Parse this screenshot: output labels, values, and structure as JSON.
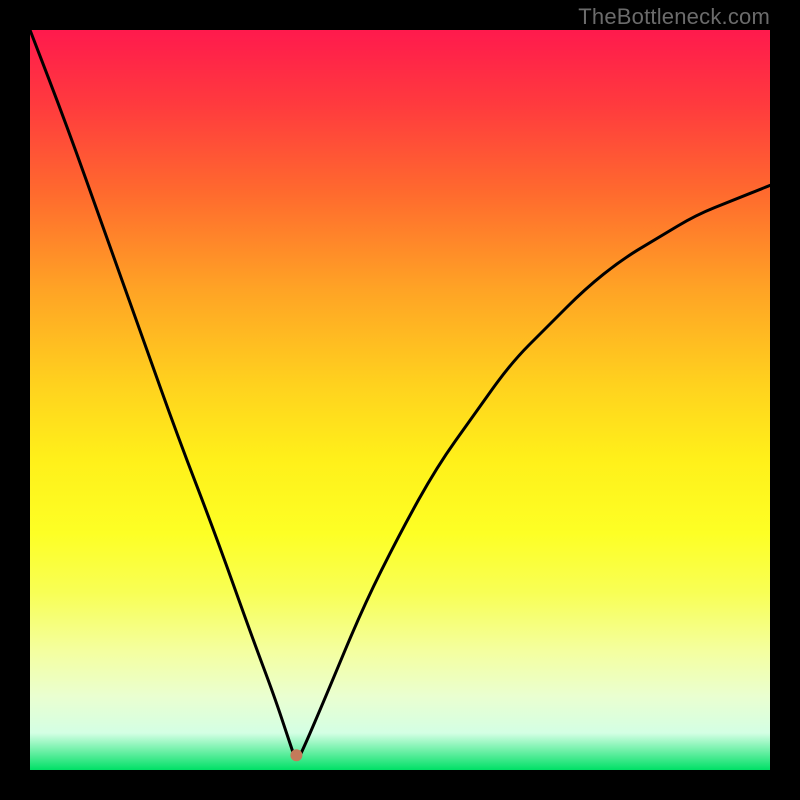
{
  "watermark": "TheBottleneck.com",
  "chart_data": {
    "type": "line",
    "title": "",
    "xlabel": "",
    "ylabel": "",
    "xlim": [
      0,
      100
    ],
    "ylim": [
      0,
      100
    ],
    "background": {
      "gradient": "vertical",
      "colors": [
        "#ff1a4d",
        "#ffd21e",
        "#fdff25",
        "#00e066"
      ],
      "meaning": "red=high bottleneck, green=low bottleneck"
    },
    "marker": {
      "x": 36,
      "y": 2,
      "color": "#c47a5a"
    },
    "series": [
      {
        "name": "bottleneck-curve",
        "x": [
          0,
          5,
          10,
          15,
          20,
          25,
          30,
          33,
          35,
          36,
          37,
          40,
          45,
          50,
          55,
          60,
          65,
          70,
          75,
          80,
          85,
          90,
          95,
          100
        ],
        "values": [
          100,
          87,
          73,
          59,
          45,
          32,
          18,
          10,
          4,
          1,
          3,
          10,
          22,
          32,
          41,
          48,
          55,
          60,
          65,
          69,
          72,
          75,
          77,
          79
        ]
      }
    ]
  },
  "colors": {
    "frame": "#000000",
    "curve": "#000000",
    "marker": "#c47a5a"
  }
}
